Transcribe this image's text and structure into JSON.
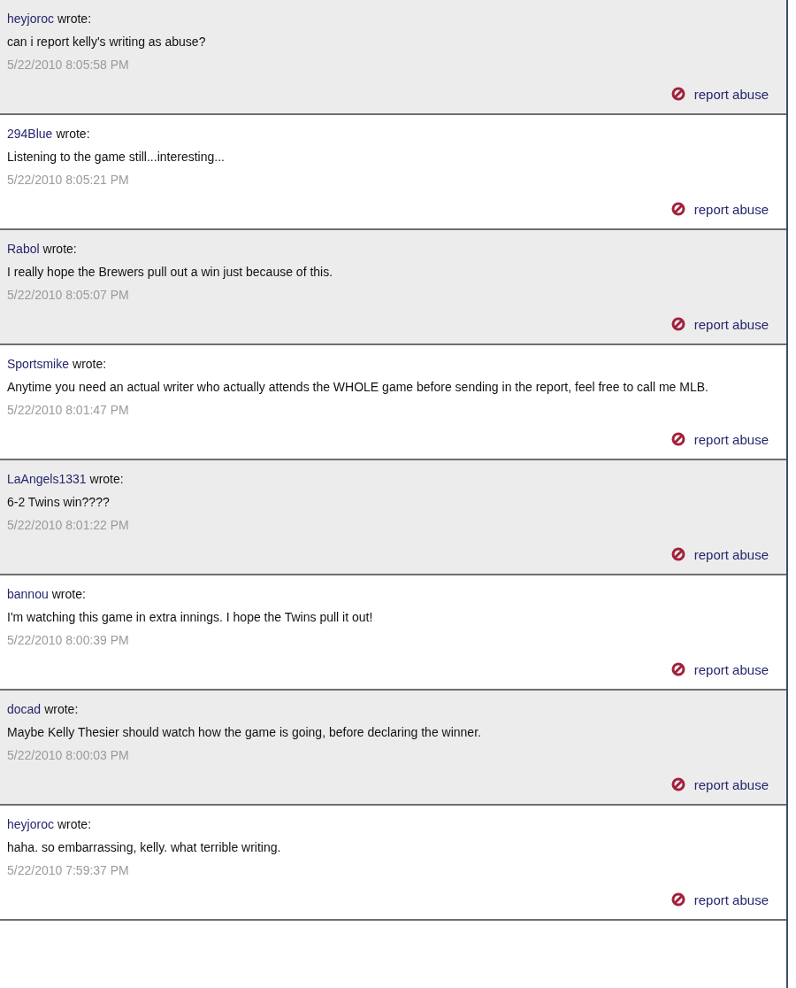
{
  "comments": [
    {
      "author": "heyjoroc",
      "wrote": "wrote:",
      "body": "can i report kelly's writing as abuse?",
      "date": "5/22/2010 8:05:58 PM",
      "report": "report abuse"
    },
    {
      "author": "294Blue",
      "wrote": "wrote:",
      "body": "Listening to the game still...interesting...",
      "date": "5/22/2010 8:05:21 PM",
      "report": "report abuse"
    },
    {
      "author": "Rabol",
      "wrote": "wrote:",
      "body": "I really hope the Brewers pull out a win just because of this.",
      "date": "5/22/2010 8:05:07 PM",
      "report": "report abuse"
    },
    {
      "author": "Sportsmike",
      "wrote": "wrote:",
      "body": "Anytime you need an actual writer who actually attends the WHOLE game before sending in the report, feel free to call me MLB.",
      "date": "5/22/2010 8:01:47 PM",
      "report": "report abuse"
    },
    {
      "author": "LaAngels1331",
      "wrote": "wrote:",
      "body": "6-2 Twins win????",
      "date": "5/22/2010 8:01:22 PM",
      "report": "report abuse"
    },
    {
      "author": "bannou",
      "wrote": "wrote:",
      "body": "I'm watching this game in extra innings. I hope the Twins pull it out!",
      "date": "5/22/2010 8:00:39 PM",
      "report": "report abuse"
    },
    {
      "author": "docad",
      "wrote": "wrote:",
      "body": "Maybe Kelly Thesier should watch how the game is going, before declaring the winner.",
      "date": "5/22/2010 8:00:03 PM",
      "report": "report abuse"
    },
    {
      "author": "heyjoroc",
      "wrote": "wrote:",
      "body": "haha. so embarrassing, kelly. what terrible writing.",
      "date": "5/22/2010 7:59:37 PM",
      "report": "report abuse"
    }
  ]
}
